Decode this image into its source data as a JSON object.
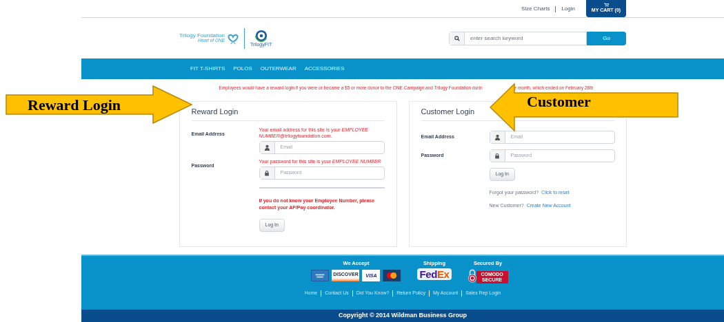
{
  "top_links": [
    {
      "label": "Size Charts"
    },
    {
      "label": "Login"
    }
  ],
  "cart": {
    "label": "MY CART (0)"
  },
  "logo": {
    "name": "Trilogy Foundation",
    "tagline": "Heart of ONE",
    "brand": "TrilogyFIT"
  },
  "search": {
    "placeholder": "enter search keyword",
    "button": "Go"
  },
  "nav": [
    {
      "label": "FIT T-SHIRTS"
    },
    {
      "label": "POLOS"
    },
    {
      "label": "OUTERWEAR"
    },
    {
      "label": "ACCESSORIES"
    }
  ],
  "notice": {
    "before": "Employees would have a reward login if you were or became a $5 or more donor to the ONE Campaign and Trilogy Foundation durin",
    "after": "e month, which ended on February 28th"
  },
  "reward_login": {
    "title": "Reward Login",
    "email_label": "Email Address",
    "email_hint": "Your email address for this site is your *EMPLOYEE NUMBER*@trilogyfoundation.com.",
    "email_placeholder": "Email",
    "password_label": "Password",
    "password_hint": "Your password for this site is your *EMPLOYEE NUMBER*",
    "password_placeholder": "Password",
    "warning": "If you do not know your Employee Number, please contact your AP/Pay coordinator.",
    "button": "Log In"
  },
  "customer_login": {
    "title": "Customer Login",
    "email_label": "Email Address",
    "email_placeholder": "Email",
    "password_label": "Password",
    "password_placeholder": "Password",
    "button": "Log In",
    "forgot_text": "Forgot your password?",
    "forgot_link": "Click to reset",
    "new_text": "New Customer?",
    "new_link": "Create New Account"
  },
  "footer": {
    "accept_heading": "We Accept",
    "shipping_heading": "Shipping",
    "secured_heading": "Secured By",
    "cards": [
      {
        "kind": "amex"
      },
      {
        "kind": "discover",
        "label": "DISCOVER"
      },
      {
        "kind": "visa",
        "label": "VISA"
      },
      {
        "kind": "mastercard"
      }
    ],
    "shipper": [
      "Fed",
      "Ex"
    ],
    "seal": "COMODO SECURE",
    "links": [
      {
        "label": "Home"
      },
      {
        "label": "Contact Us"
      },
      {
        "label": "Did You Know?"
      },
      {
        "label": "Return Policy"
      },
      {
        "label": "My Account"
      },
      {
        "label": "Sales Rep Login"
      }
    ],
    "copyright": "Copyright © 2014 Wildman Business Group"
  },
  "callouts": [
    {
      "text": "Reward Login",
      "kind": "arrow_right"
    },
    {
      "text": "Customer",
      "kind": "arrow_left"
    }
  ]
}
